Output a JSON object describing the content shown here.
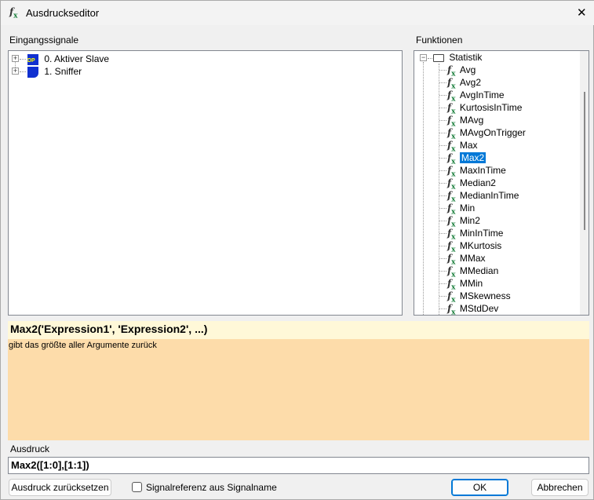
{
  "window": {
    "title": "Ausdruckseditor",
    "close": "✕"
  },
  "inputs": {
    "label": "Eingangssignale",
    "items": [
      {
        "label": "0. Aktiver Slave",
        "icon": "dp-slave-icon"
      },
      {
        "label": "1. Sniffer",
        "icon": "sniffer-icon"
      }
    ]
  },
  "functions": {
    "label": "Funktionen",
    "folder": "Statistik",
    "selected": "Max2",
    "items": [
      "Avg",
      "Avg2",
      "AvgInTime",
      "KurtosisInTime",
      "MAvg",
      "MAvgOnTrigger",
      "Max",
      "Max2",
      "MaxInTime",
      "Median2",
      "MedianInTime",
      "Min",
      "Min2",
      "MinInTime",
      "MKurtosis",
      "MMax",
      "MMedian",
      "MMin",
      "MSkewness",
      "MStdDev"
    ]
  },
  "signature": "Max2('Expression1', 'Expression2', ...)",
  "description": "gibt das größte aller Argumente zurück",
  "expression": {
    "label": "Ausdruck",
    "value": "Max2([1:0],[1:1])"
  },
  "buttons": {
    "reset": "Ausdruck zurücksetzen",
    "checkbox": "Signalreferenz aus Signalname",
    "ok": "OK",
    "cancel": "Abbrechen"
  },
  "colors": {
    "signature_bg": "#fff8d8",
    "description_bg": "#fddcaa",
    "accent": "#0078d7"
  }
}
